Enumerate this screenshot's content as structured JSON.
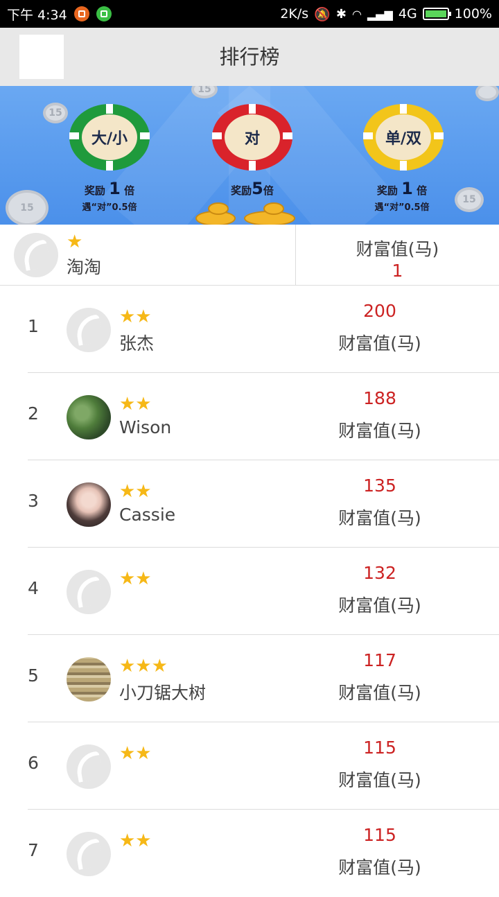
{
  "status_bar": {
    "time": "下午 4:34",
    "speed": "2K/s",
    "network": "4G",
    "battery": "100%"
  },
  "header": {
    "title": "排行榜"
  },
  "banner": {
    "chips": [
      {
        "label": "大/小",
        "reward_prefix": "奖励",
        "multiplier": "1",
        "reward_suffix": "倍",
        "note": "遇“对”0.5倍",
        "color": "#1f9a3c"
      },
      {
        "label": "对",
        "reward_prefix": "奖励",
        "multiplier": "5",
        "reward_suffix": "倍",
        "note": "",
        "color": "#d9232b"
      },
      {
        "label": "单/双",
        "reward_prefix": "奖励",
        "multiplier": "1",
        "reward_suffix": "倍",
        "note": "遇“对”0.5倍",
        "color": "#f2c51a"
      }
    ]
  },
  "me": {
    "name": "淘淘",
    "stars": "★",
    "wealth_label": "财富值(马)",
    "wealth_value": "1"
  },
  "ranking": [
    {
      "rank": "1",
      "name": "张杰",
      "stars": "★★",
      "value": "200",
      "unit": "财富值(马)"
    },
    {
      "rank": "2",
      "name": "Wison",
      "stars": "★★",
      "value": "188",
      "unit": "财富值(马)"
    },
    {
      "rank": "3",
      "name": "Cassie",
      "stars": "★★",
      "value": "135",
      "unit": "财富值(马)"
    },
    {
      "rank": "4",
      "name": "",
      "stars": "★★",
      "value": "132",
      "unit": "财富值(马)"
    },
    {
      "rank": "5",
      "name": "小刀锯大树",
      "stars": "★★★",
      "value": "117",
      "unit": "财富值(马)"
    },
    {
      "rank": "6",
      "name": "",
      "stars": "★★",
      "value": "115",
      "unit": "财富值(马)"
    },
    {
      "rank": "7",
      "name": "",
      "stars": "★★",
      "value": "115",
      "unit": "财富值(马)"
    }
  ]
}
